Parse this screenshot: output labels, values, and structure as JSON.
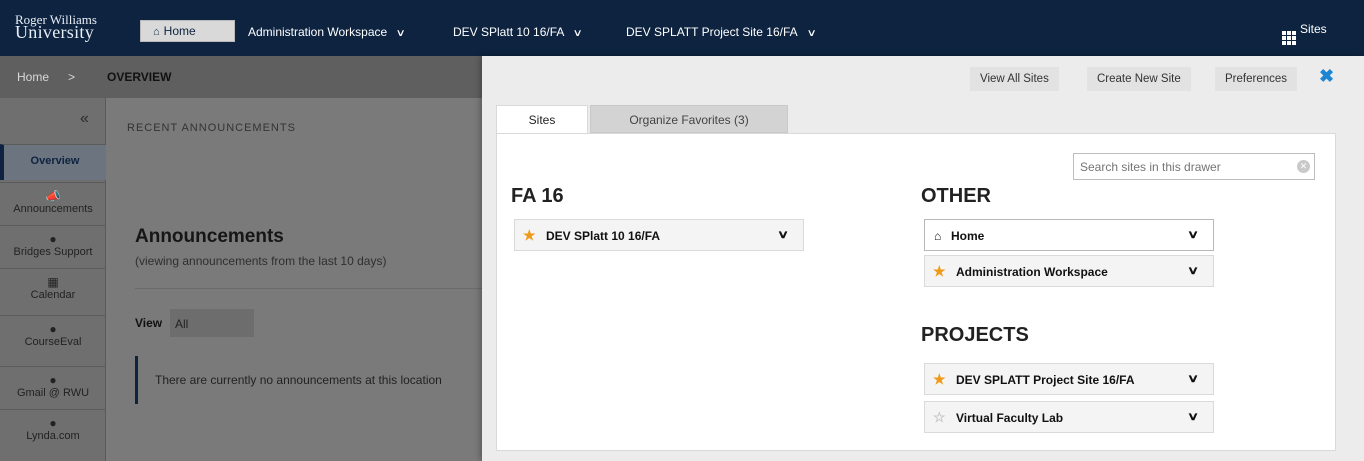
{
  "topbar": {
    "logo_line1": "Roger Williams",
    "logo_line2": "University",
    "home_label": "Home",
    "nav": [
      {
        "label": "Administration Workspace"
      },
      {
        "label": "DEV SPlatt 10 16/FA"
      },
      {
        "label": "DEV SPLATT Project Site 16/FA"
      }
    ],
    "sites_label": "Sites"
  },
  "breadcrumb": {
    "home": "Home",
    "separator": ">",
    "current": "OVERVIEW"
  },
  "sidebar": {
    "collapse_glyph": "«",
    "items": [
      {
        "label": "Overview",
        "icon": ""
      },
      {
        "label": "Announcements",
        "icon": "megaphone-icon"
      },
      {
        "label": "Bridges Support",
        "icon": "globe-icon"
      },
      {
        "label": "Calendar",
        "icon": "calendar-icon"
      },
      {
        "label": "CourseEval",
        "icon": "globe-icon"
      },
      {
        "label": "Gmail @ RWU",
        "icon": "globe-icon"
      },
      {
        "label": "Lynda.com",
        "icon": "globe-icon"
      }
    ]
  },
  "main": {
    "recent_title": "RECENT ANNOUNCEMENTS",
    "announcements_title": "Announcements",
    "announcements_sub": "(viewing announcements from the last 10 days)",
    "view_label": "View",
    "view_value": "All",
    "empty_message": "There are currently no announcements at this location"
  },
  "drawer": {
    "buttons": {
      "view_all": "View All Sites",
      "create_new": "Create New Site",
      "preferences": "Preferences"
    },
    "tabs": {
      "sites": "Sites",
      "organize": "Organize Favorites (3)"
    },
    "search_placeholder": "Search sites in this drawer",
    "sections": {
      "fa16": {
        "title": "FA 16",
        "sites": [
          {
            "name": "DEV SPlatt 10 16/FA",
            "favorite": true
          }
        ]
      },
      "other": {
        "title": "OTHER",
        "sites": [
          {
            "name": "Home",
            "icon": "home-icon"
          },
          {
            "name": "Administration Workspace",
            "favorite": true
          }
        ]
      },
      "projects": {
        "title": "PROJECTS",
        "sites": [
          {
            "name": "DEV SPLATT Project Site 16/FA",
            "favorite": true
          },
          {
            "name": "Virtual Faculty Lab",
            "favorite": false
          }
        ]
      }
    }
  },
  "colors": {
    "navy": "#0d2340",
    "favorite_star": "#f09a1a",
    "close_blue": "#1d86d3"
  }
}
